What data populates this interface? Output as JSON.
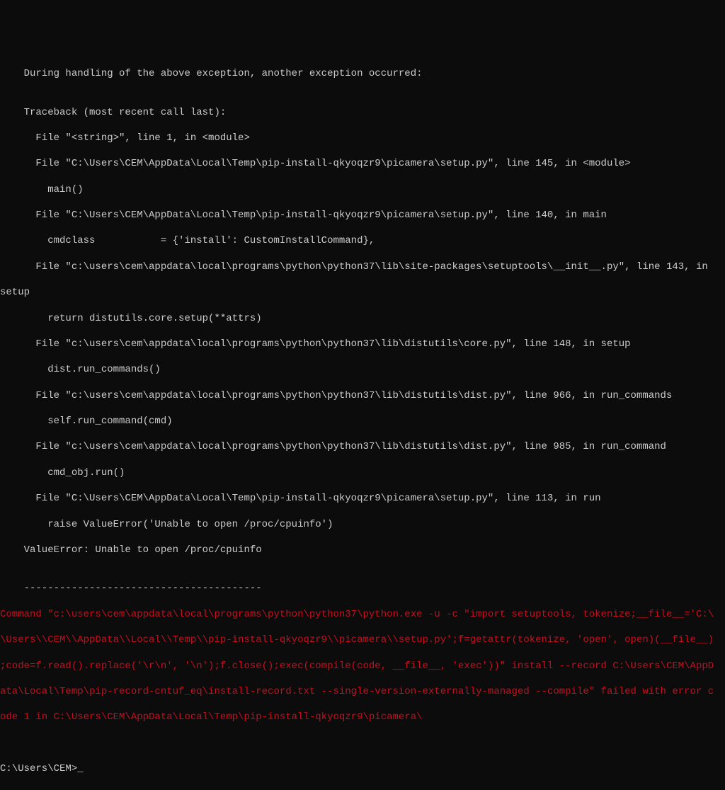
{
  "terminal": {
    "lines": [
      "    During handling of the above exception, another exception occurred:",
      "",
      "    Traceback (most recent call last):",
      "      File \"<string>\", line 1, in <module>",
      "      File \"C:\\Users\\CEM\\AppData\\Local\\Temp\\pip-install-qkyoqzr9\\picamera\\setup.py\", line 145, in <module>",
      "        main()",
      "      File \"C:\\Users\\CEM\\AppData\\Local\\Temp\\pip-install-qkyoqzr9\\picamera\\setup.py\", line 140, in main",
      "        cmdclass           = {'install': CustomInstallCommand},",
      "      File \"c:\\users\\cem\\appdata\\local\\programs\\python\\python37\\lib\\site-packages\\setuptools\\__init__.py\", line 143, in ",
      "setup",
      "        return distutils.core.setup(**attrs)",
      "      File \"c:\\users\\cem\\appdata\\local\\programs\\python\\python37\\lib\\distutils\\core.py\", line 148, in setup",
      "        dist.run_commands()",
      "      File \"c:\\users\\cem\\appdata\\local\\programs\\python\\python37\\lib\\distutils\\dist.py\", line 966, in run_commands",
      "        self.run_command(cmd)",
      "      File \"c:\\users\\cem\\appdata\\local\\programs\\python\\python37\\lib\\distutils\\dist.py\", line 985, in run_command",
      "        cmd_obj.run()",
      "      File \"C:\\Users\\CEM\\AppData\\Local\\Temp\\pip-install-qkyoqzr9\\picamera\\setup.py\", line 113, in run",
      "        raise ValueError('Unable to open /proc/cpuinfo')",
      "    ValueError: Unable to open /proc/cpuinfo",
      "",
      "    ----------------------------------------"
    ],
    "error_lines": [
      "Command \"c:\\users\\cem\\appdata\\local\\programs\\python\\python37\\python.exe -u -c \"import setuptools, tokenize;__file__='C:\\",
      "\\Users\\\\CEM\\\\AppData\\\\Local\\\\Temp\\\\pip-install-qkyoqzr9\\\\picamera\\\\setup.py';f=getattr(tokenize, 'open', open)(__file__)",
      ";code=f.read().replace('\\r\\n', '\\n');f.close();exec(compile(code, __file__, 'exec'))\" install --record C:\\Users\\CEM\\AppD",
      "ata\\Local\\Temp\\pip-record-cntuf_eq\\install-record.txt --single-version-externally-managed --compile\" failed with error c",
      "ode 1 in C:\\Users\\CEM\\AppData\\Local\\Temp\\pip-install-qkyoqzr9\\picamera\\"
    ],
    "prompt": "C:\\Users\\CEM>",
    "cursor": "_"
  }
}
